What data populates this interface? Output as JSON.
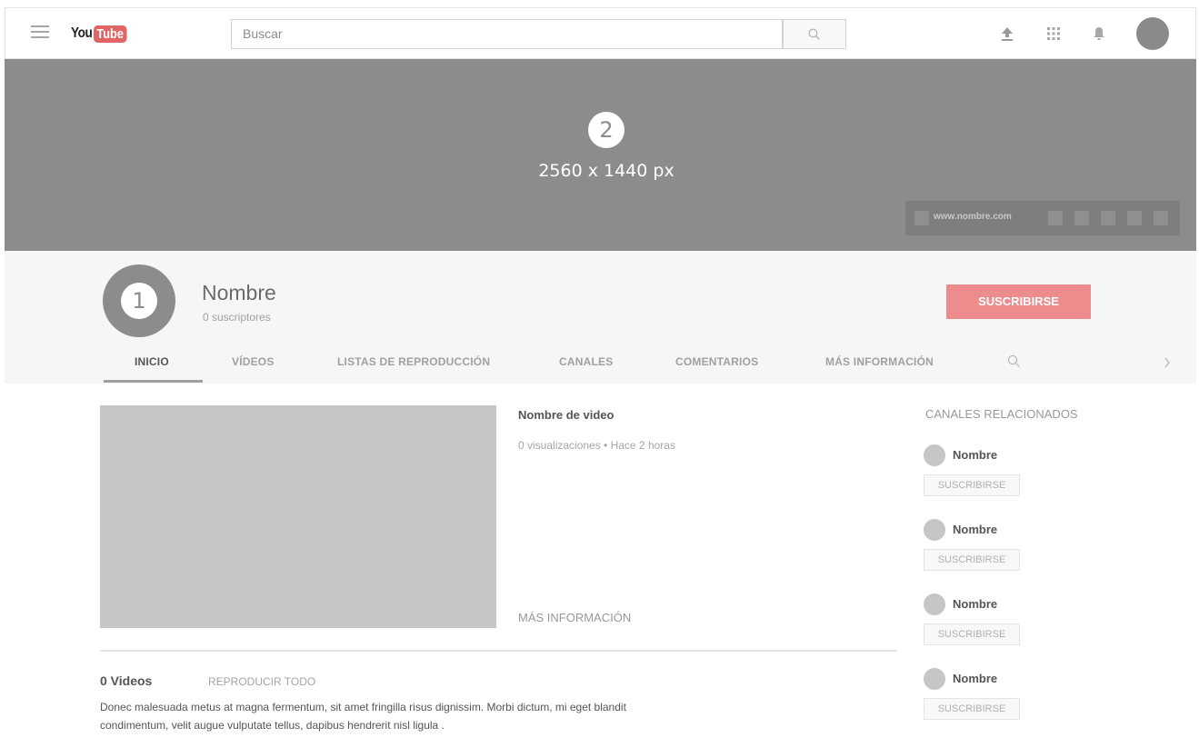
{
  "topbar": {
    "logo_you": "You",
    "logo_tube": "Tube",
    "search_placeholder": "Buscar"
  },
  "banner": {
    "number": "2",
    "size_label": "2560 x 1440 px",
    "website": "www.nombre.com"
  },
  "channel": {
    "avatar_number": "1",
    "name": "Nombre",
    "subscribers": "0 suscriptores",
    "subscribe_label": "SUSCRIBIRSE"
  },
  "tabs": [
    {
      "label": "INICIO",
      "active": true
    },
    {
      "label": "VÍDEOS"
    },
    {
      "label": "LISTAS DE REPRODUCCIÓN"
    },
    {
      "label": "CANALES"
    },
    {
      "label": "COMENTARIOS"
    },
    {
      "label": "MÁS INFORMACIÓN"
    }
  ],
  "featured_video": {
    "title": "Nombre de video",
    "meta": "0 visualizaciones • Hace 2 horas",
    "more_info": "MÁS INFORMACIÓN"
  },
  "videos_section": {
    "count_label": "0 Videos",
    "play_all": "REPRODUCIR TODO",
    "description": "Donec malesuada metus at magna fermentum, sit amet fringilla risus dignissim. Morbi dictum, mi eget blandit condimentum, velit augue vulputate tellus, dapibus hendrerit nisl ligula ."
  },
  "related": {
    "title": "CANALES RELACIONADOS",
    "channels": [
      {
        "name": "Nombre",
        "button": "SUSCRIBIRSE"
      },
      {
        "name": "Nombre",
        "button": "SUSCRIBIRSE"
      },
      {
        "name": "Nombre",
        "button": "SUSCRIBIRSE"
      },
      {
        "name": "Nombre",
        "button": "SUSCRIBIRSE"
      }
    ]
  },
  "colors": {
    "banner": "#8b8c8e",
    "subscribe_accent": "#ec8c8d",
    "logo_red": "#e06666"
  },
  "icons": [
    "menu-icon",
    "search-icon",
    "upload-icon",
    "apps-icon",
    "bell-icon",
    "chevron-right-icon"
  ]
}
